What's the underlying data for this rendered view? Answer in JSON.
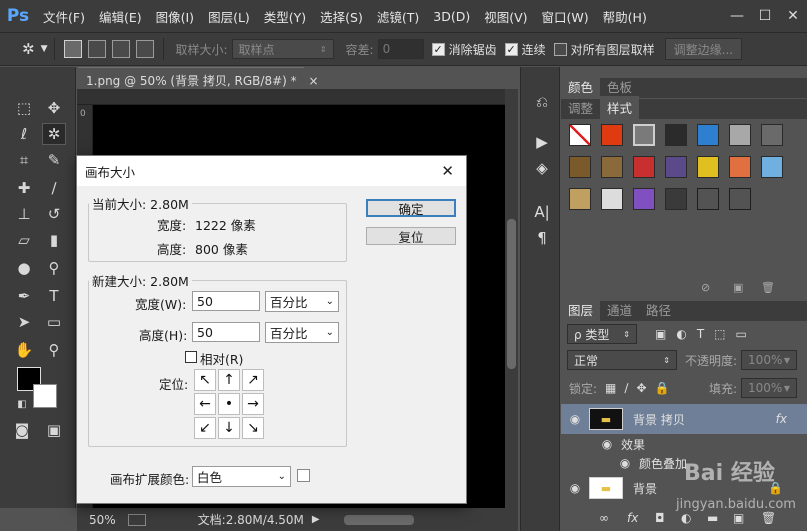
{
  "app": {
    "logo": "Ps"
  },
  "menu": [
    "文件(F)",
    "编辑(E)",
    "图像(I)",
    "图层(L)",
    "类型(Y)",
    "选择(S)",
    "滤镜(T)",
    "3D(D)",
    "视图(V)",
    "窗口(W)",
    "帮助(H)"
  ],
  "window_controls": {
    "minimize": "—",
    "maximize": "☐",
    "close": "✕"
  },
  "options": {
    "sample_size_label": "取样大小:",
    "sample_size_value": "取样点",
    "tolerance_label": "容差:",
    "tolerance_value": "0",
    "antialias_label": "消除锯齿",
    "antialias_checked": true,
    "contiguous_label": "连续",
    "contiguous_checked": true,
    "all_layers_label": "对所有图层取样",
    "all_layers_checked": false,
    "refine_edge_label": "调整边缘..."
  },
  "document": {
    "tab_title": "1.png @ 50% (背景 拷贝, RGB/8#) *",
    "tab_close": "×",
    "ruler_zero": "0",
    "zoom": "50%",
    "doc_info": "文档:2.80M/4.50M"
  },
  "panels": {
    "color_tabs": [
      "颜色",
      "色板"
    ],
    "style_tabs": [
      "调整",
      "样式"
    ],
    "layer_tabs": [
      "图层",
      "通道",
      "路径"
    ]
  },
  "styles_swatches": [
    {
      "color": "#ffffff",
      "kind": "none"
    },
    {
      "color": "#e03a10",
      "kind": "fill"
    },
    {
      "color": "#7a7a7a",
      "kind": "selected"
    },
    {
      "color": "#2b2b2b",
      "kind": "fill"
    },
    {
      "color": "#2f7fd0",
      "kind": "fill"
    },
    {
      "color": "#a8a8a8",
      "kind": "fill"
    },
    {
      "color": "#6a6a6a",
      "kind": "fill"
    },
    {
      "color": "#7a5a2a",
      "kind": "fill"
    },
    {
      "color": "#8a6a3a",
      "kind": "fill"
    },
    {
      "color": "#c83030",
      "kind": "fill"
    },
    {
      "color": "#5a4a8a",
      "kind": "fill"
    },
    {
      "color": "#e0c020",
      "kind": "fill"
    },
    {
      "color": "#e07040",
      "kind": "fill"
    },
    {
      "color": "#70b0e0",
      "kind": "fill"
    },
    {
      "color": "#c0a060",
      "kind": "fill"
    },
    {
      "color": "#dcdcdc",
      "kind": "fill"
    },
    {
      "color": "#8050c0",
      "kind": "fill"
    },
    {
      "color": "#3a3a3a",
      "kind": "fill"
    },
    {
      "color": "#3a3a3a",
      "kind": "outline"
    },
    {
      "color": "#3a3a3a",
      "kind": "outline"
    }
  ],
  "layers": {
    "filter_label": "ρ 类型",
    "blend_mode": "正常",
    "opacity_label": "不透明度:",
    "opacity_value": "100%",
    "lock_label": "锁定:",
    "fill_label": "填充:",
    "fill_value": "100%",
    "items": [
      {
        "name": "背景 拷贝",
        "fx": "fx",
        "selected": true
      },
      {
        "name": "效果",
        "indent": 1
      },
      {
        "name": "颜色叠加",
        "indent": 2
      },
      {
        "name": "背景",
        "locked": true
      }
    ]
  },
  "dialog": {
    "title": "画布大小",
    "current_legend": "当前大小: 2.80M",
    "cur_width_label": "宽度:",
    "cur_width_value": "1222 像素",
    "cur_height_label": "高度:",
    "cur_height_value": "800 像素",
    "new_legend": "新建大小: 2.80M",
    "width_label": "宽度(W):",
    "width_value": "50",
    "width_unit": "百分比",
    "height_label": "高度(H):",
    "height_value": "50",
    "height_unit": "百分比",
    "relative_label": "相对(R)",
    "relative_checked": false,
    "anchor_label": "定位:",
    "anchor_arrows": [
      "↖",
      "↑",
      "↗",
      "←",
      "•",
      "→",
      "↙",
      "↓",
      "↘"
    ],
    "ok_label": "确定",
    "reset_label": "复位",
    "extension_color_label": "画布扩展颜色:",
    "extension_color_value": "白色"
  },
  "watermark": {
    "brand": "Bai 经验",
    "url": "jingyan.baidu.com"
  }
}
